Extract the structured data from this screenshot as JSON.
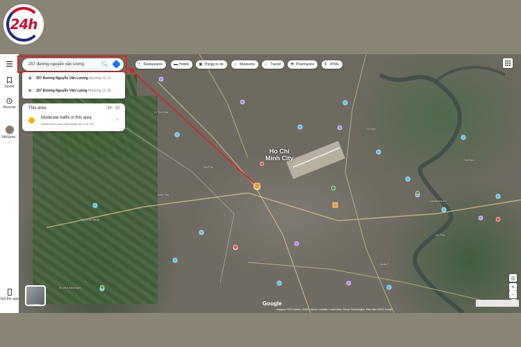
{
  "brand": {
    "logo_text": "24h"
  },
  "rail": {
    "menu_label": "",
    "saved": "Saved",
    "recents": "Recents",
    "account": "24hStore - ...",
    "get_app": "Get the app"
  },
  "search": {
    "value": "257 đường nguyễn văn lượng"
  },
  "suggestions": [
    {
      "bold": "257 Đường Nguyễn Văn Lượng",
      "rest": " phường 10, G..."
    },
    {
      "bold": "257 Đường Nguyễn Văn Luông",
      "rest": " Phường 11, Di..."
    }
  ],
  "area": {
    "title": "This area",
    "temperature": "29°",
    "traffic": "Moderate traffic in this area",
    "traffic_detail": "Slower than usual with delays up to 15 min"
  },
  "chips": [
    {
      "icon": "fork-knife-icon",
      "label": "Restaurants"
    },
    {
      "icon": "bed-icon",
      "label": "Hotels"
    },
    {
      "icon": "camera-icon",
      "label": "Things to do"
    },
    {
      "icon": "museum-icon",
      "label": "Museums"
    },
    {
      "icon": "train-icon",
      "label": "Transit"
    },
    {
      "icon": "pill-icon",
      "label": "Pharmacies"
    },
    {
      "icon": "atm-icon",
      "label": "ATMs"
    }
  ],
  "map": {
    "city_label": "Ho Chi Minh City",
    "city_line1": "Ho Chi",
    "city_line2": "Minh City",
    "layers_label": "Layers",
    "google_label": "Google",
    "attribution": "Imagery ©2023 Airbus, CNES / Airbus, Landsat / Copernicus, Maxar Technologies, Map data ©2023 Google",
    "place_labels": [
      "Di Tích Địa",
      "Đạo Phật Tăng",
      "Tu viện Kiều Đàm",
      "Landmark 81",
      "Gò Vấp",
      "Thủ Đức",
      "An Phú",
      "Tân Phú",
      "Bình Tân",
      "Quận 7"
    ]
  },
  "colors": {
    "highlight": "#e02020",
    "accent": "#1a73e8",
    "traffic_dot": "#f6b400",
    "page_background": "#8b8578"
  }
}
